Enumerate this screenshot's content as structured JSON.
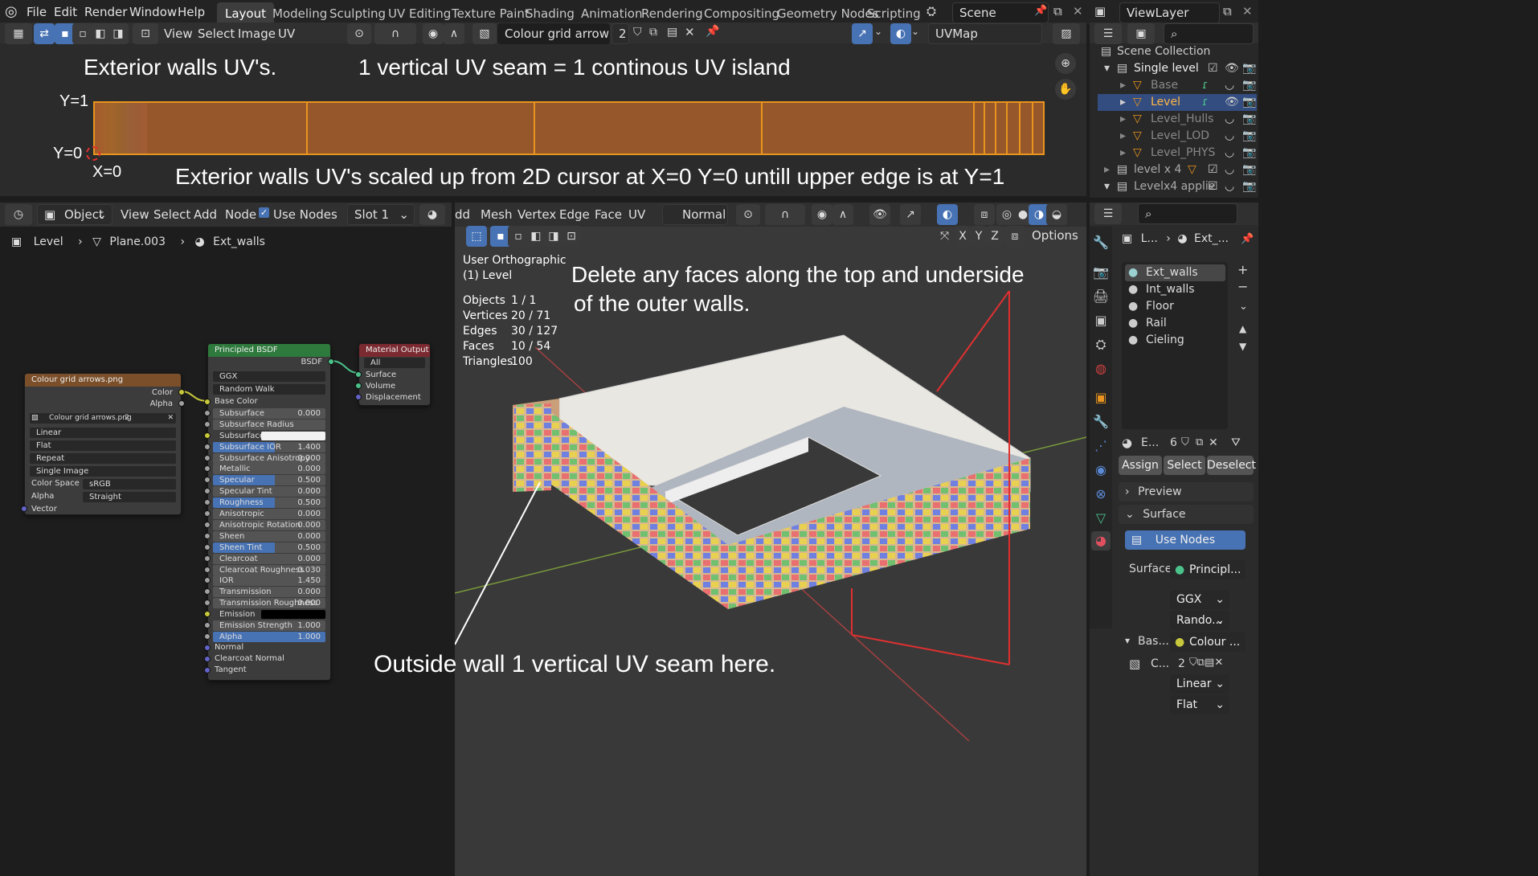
{
  "topbar": {
    "menus": [
      "File",
      "Edit",
      "Render",
      "Window",
      "Help"
    ],
    "workspaces": [
      "Layout",
      "Modeling",
      "Sculpting",
      "UV Editing",
      "Texture Paint",
      "Shading",
      "Animation",
      "Rendering",
      "Compositing",
      "Geometry Nodes",
      "Scripting"
    ],
    "scene": "Scene",
    "viewlayer": "ViewLayer"
  },
  "uv_editor": {
    "menus": [
      "View",
      "Select",
      "Image",
      "UV"
    ],
    "image_name": "Colour grid arrows.png",
    "user_count": "2",
    "uvmap": "UVMap",
    "note_title": "Exterior walls UV's.",
    "note_seam": "1 vertical UV seam = 1 continous UV island",
    "label_y1": "Y=1",
    "label_y0": "Y=0",
    "label_x0": "X=0",
    "note_scaled": "Exterior walls UV's scaled up from 2D cursor at  X=0 Y=0 untill upper edge is at Y=1"
  },
  "outliner": {
    "scene_collection": "Scene Collection",
    "items": [
      {
        "label": "Single level"
      },
      {
        "label": "Base"
      },
      {
        "label": "Level"
      },
      {
        "label": "Level_Hulls"
      },
      {
        "label": "Level_LOD"
      },
      {
        "label": "Level_PHYS"
      },
      {
        "label": "level x 4"
      },
      {
        "label": "Levelx4 applie"
      }
    ]
  },
  "node_editor": {
    "mode": "Object",
    "menus": [
      "View",
      "Select",
      "Add",
      "Node"
    ],
    "use_nodes": "Use Nodes",
    "slot": "Slot 1",
    "breadcrumb": [
      "Level",
      "Plane.003",
      "Ext_walls"
    ],
    "image_node": {
      "title": "Colour grid arrows.png",
      "out_color": "Color",
      "out_alpha": "Alpha",
      "image": "Colour grid arrows.png",
      "users": "2",
      "interp": "Linear",
      "projection": "Flat",
      "extension": "Repeat",
      "source": "Single Image",
      "colorspace_label": "Color Space",
      "colorspace": "sRGB",
      "alpha_label": "Alpha",
      "alpha": "Straight",
      "vector": "Vector"
    },
    "bsdf_node": {
      "title": "Principled BSDF",
      "out": "BSDF",
      "distribution": "GGX",
      "subsurface_method": "Random Walk",
      "rows": [
        {
          "label": "Base Color",
          "value": "",
          "kind": "socket"
        },
        {
          "label": "Subsurface",
          "value": "0.000",
          "kind": "num"
        },
        {
          "label": "Subsurface Radius",
          "value": "",
          "kind": "num"
        },
        {
          "label": "Subsurface Co...",
          "value": "",
          "kind": "color"
        },
        {
          "label": "Subsurface IOR",
          "value": "1.400",
          "kind": "blue"
        },
        {
          "label": "Subsurface Anisotropy",
          "value": "0.000",
          "kind": "num"
        },
        {
          "label": "Metallic",
          "value": "0.000",
          "kind": "num"
        },
        {
          "label": "Specular",
          "value": "0.500",
          "kind": "blue"
        },
        {
          "label": "Specular Tint",
          "value": "0.000",
          "kind": "num"
        },
        {
          "label": "Roughness",
          "value": "0.500",
          "kind": "blue"
        },
        {
          "label": "Anisotropic",
          "value": "0.000",
          "kind": "num"
        },
        {
          "label": "Anisotropic Rotation",
          "value": "0.000",
          "kind": "num"
        },
        {
          "label": "Sheen",
          "value": "0.000",
          "kind": "num"
        },
        {
          "label": "Sheen Tint",
          "value": "0.500",
          "kind": "blue"
        },
        {
          "label": "Clearcoat",
          "value": "0.000",
          "kind": "num"
        },
        {
          "label": "Clearcoat Roughness",
          "value": "0.030",
          "kind": "num"
        },
        {
          "label": "IOR",
          "value": "1.450",
          "kind": "num"
        },
        {
          "label": "Transmission",
          "value": "0.000",
          "kind": "num"
        },
        {
          "label": "Transmission Roughness",
          "value": "0.000",
          "kind": "num"
        },
        {
          "label": "Emission",
          "value": "",
          "kind": "black"
        },
        {
          "label": "Emission Strength",
          "value": "1.000",
          "kind": "num"
        },
        {
          "label": "Alpha",
          "value": "1.000",
          "kind": "full"
        },
        {
          "label": "Normal",
          "value": "",
          "kind": "socket"
        },
        {
          "label": "Clearcoat Normal",
          "value": "",
          "kind": "socket"
        },
        {
          "label": "Tangent",
          "value": "",
          "kind": "socket"
        }
      ]
    },
    "output_node": {
      "title": "Material Output",
      "target": "All",
      "inputs": [
        "Surface",
        "Volume",
        "Displacement"
      ]
    }
  },
  "viewport": {
    "menus": [
      "dd",
      "Mesh",
      "Vertex",
      "Edge",
      "Face",
      "UV"
    ],
    "transform": "Normal",
    "options": "Options",
    "axes": [
      "X",
      "Y",
      "Z"
    ],
    "view_name": "User Orthographic",
    "object_name": "(1) Level",
    "stats": [
      {
        "label": "Objects",
        "value": "1 / 1"
      },
      {
        "label": "Vertices",
        "value": "20 / 71"
      },
      {
        "label": "Edges",
        "value": "30 / 127"
      },
      {
        "label": "Faces",
        "value": "10 / 54"
      },
      {
        "label": "Triangles",
        "value": "100"
      }
    ],
    "note_delete_1": "Delete any faces along the top and underside",
    "note_delete_2": "of the outer walls.",
    "note_seam": "Outside wall 1 vertical UV seam here."
  },
  "properties": {
    "breadcrumb_obj": "L...",
    "breadcrumb_mat": "Ext_...",
    "materials": [
      "Ext_walls",
      "Int_walls",
      "Floor",
      "Rail",
      "Cieling"
    ],
    "mat_short": "E...",
    "mat_users": "6",
    "assign": "Assign",
    "select": "Select",
    "deselect": "Deselect",
    "preview": "Preview",
    "surface_panel": "Surface",
    "use_nodes": "Use Nodes",
    "surface_label": "Surface",
    "surface_value": "Principl...",
    "ggx": "GGX",
    "random": "Rando...",
    "base_label": "Bas...",
    "base_value": "Colour ...",
    "img_short": "C...",
    "img_users": "2",
    "linear": "Linear",
    "flat": "Flat"
  }
}
